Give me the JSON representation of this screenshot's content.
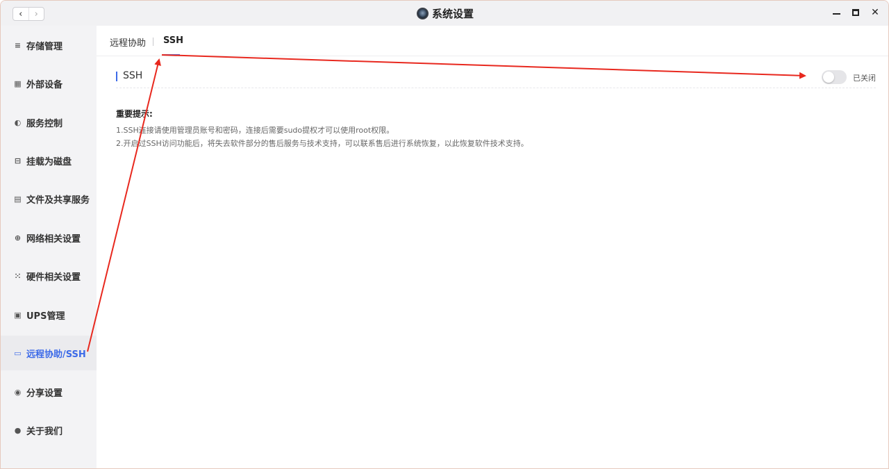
{
  "window": {
    "title": "系统设置",
    "back_glyph": "‹",
    "forward_glyph": "›",
    "minimize_icon": "minimize-icon",
    "maximize_icon": "maximize-icon",
    "close_glyph": "✕"
  },
  "sidebar": {
    "items": [
      {
        "label": "存储管理",
        "icon": "database-icon",
        "glyph": "≡"
      },
      {
        "label": "外部设备",
        "icon": "external-device-icon",
        "glyph": "▦"
      },
      {
        "label": "服务控制",
        "icon": "toggle-icon",
        "glyph": "◐"
      },
      {
        "label": "挂载为磁盘",
        "icon": "disk-mount-icon",
        "glyph": "⊟"
      },
      {
        "label": "文件及共享服务",
        "icon": "file-share-icon",
        "glyph": "▤"
      },
      {
        "label": "网络相关设置",
        "icon": "globe-icon",
        "glyph": "⊕"
      },
      {
        "label": "硬件相关设置",
        "icon": "grid-icon",
        "glyph": "⁙"
      },
      {
        "label": "UPS管理",
        "icon": "ups-icon",
        "glyph": "▣"
      },
      {
        "label": "远程协助/SSH",
        "icon": "remote-icon",
        "glyph": "▭"
      },
      {
        "label": "分享设置",
        "icon": "share-icon",
        "glyph": "◉"
      },
      {
        "label": "关于我们",
        "icon": "info-icon",
        "glyph": "●"
      }
    ],
    "active_index": 8
  },
  "tabs": [
    {
      "label": "远程协助"
    },
    {
      "label": "SSH"
    }
  ],
  "section": {
    "title": "SSH",
    "toggle_state": "off",
    "toggle_label": "已关闭"
  },
  "notice": {
    "title": "重要提示:",
    "lines": [
      "1.SSH连接请使用管理员账号和密码，连接后需要sudo提权才可以使用root权限。",
      "2.开启过SSH访问功能后，将失去软件部分的售后服务与技术支持，可以联系售后进行系统恢复，以此恢复软件技术支持。"
    ]
  },
  "colors": {
    "accent": "#3c6ae8",
    "annotation_arrow": "#e8281e"
  }
}
